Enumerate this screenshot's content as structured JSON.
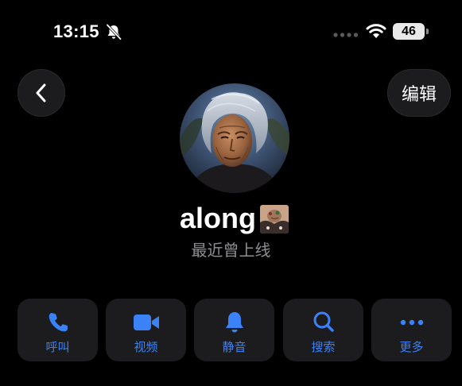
{
  "status_bar": {
    "time": "13:15",
    "battery": "46"
  },
  "nav": {
    "back_icon": "chevron-left-icon",
    "edit_label": "编辑"
  },
  "profile": {
    "name": "along",
    "status": "最近曾上线"
  },
  "actions": [
    {
      "label": "呼叫",
      "icon": "phone-icon"
    },
    {
      "label": "视频",
      "icon": "video-icon"
    },
    {
      "label": "静音",
      "icon": "bell-icon"
    },
    {
      "label": "搜索",
      "icon": "search-icon"
    },
    {
      "label": "更多",
      "icon": "more-icon"
    }
  ],
  "colors": {
    "accent": "#3b82f6",
    "button_bg": "#1c1c1e",
    "secondary_text": "#8e8e93",
    "background": "#000000"
  }
}
